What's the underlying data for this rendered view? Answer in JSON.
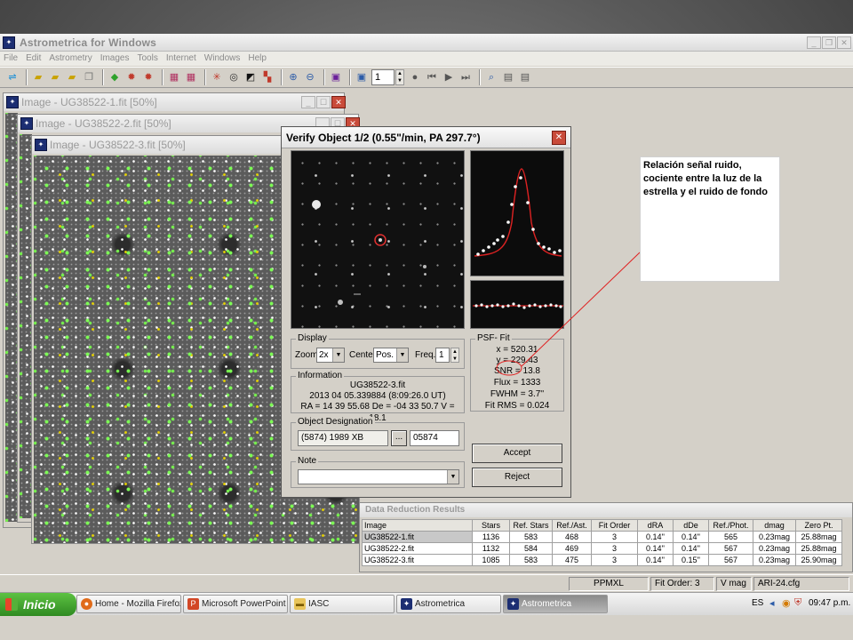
{
  "app": {
    "title": "Astrometrica for Windows",
    "menu": [
      "File",
      "Edit",
      "Astrometry",
      "Images",
      "Tools",
      "Internet",
      "Windows",
      "Help"
    ],
    "toolbar_field_value": "1"
  },
  "image_windows": [
    {
      "title": "Image - UG38522-1.fit [50%]"
    },
    {
      "title": "Image - UG38522-2.fit [50%]"
    },
    {
      "title": "Image - UG38522-3.fit [50%]"
    }
  ],
  "verify": {
    "title": "Verify Object 1/2 (0.55\"/min, PA 297.7°)",
    "display": {
      "label": "Display",
      "zoom_label": "Zoom",
      "zoom_value": "2x",
      "center_label": "Center",
      "center_value": "Pos. 2",
      "freq_label": "Freq.",
      "freq_value": "1"
    },
    "psf": {
      "label": "PSF- Fit",
      "x": "x = 520.31",
      "y": "y = 229.43",
      "snr": "SNR = 13.8",
      "flux": "Flux = 1333",
      "fwhm": "FWHM = 3.7''",
      "fit_rms": "Fit RMS = 0.024"
    },
    "information": {
      "label": "Information",
      "file": "UG38522-3.fit",
      "date": "2013 04 05.339884 (8:09:26.0 UT)",
      "coords": "RA = 14 39 55.68   De = -04 33 50.7   V = 18.1"
    },
    "designation": {
      "label": "Object Designation",
      "name": "(5874) 1989 XB",
      "browse": "...",
      "number": "05874"
    },
    "note": {
      "label": "Note",
      "value": ""
    },
    "accept_label": "Accept",
    "reject_label": "Reject"
  },
  "annotation": {
    "text": "Relación señal ruido, cociente entre la luz de la estrella y el ruido de fondo"
  },
  "data_reduction": {
    "title": "Data Reduction Results",
    "columns": [
      "Image",
      "Stars",
      "Ref. Stars",
      "Ref./Ast.",
      "Fit Order",
      "dRA",
      "dDe",
      "Ref./Phot.",
      "dmag",
      "Zero Pt."
    ],
    "rows": [
      [
        "UG38522-1.fit",
        "1136",
        "583",
        "468",
        "3",
        "0.14''",
        "0.14''",
        "565",
        "0.23mag",
        "25.88mag"
      ],
      [
        "UG38522-2.fit",
        "1132",
        "584",
        "469",
        "3",
        "0.14''",
        "0.14''",
        "567",
        "0.23mag",
        "25.88mag"
      ],
      [
        "UG38522-3.fit",
        "1085",
        "583",
        "475",
        "3",
        "0.14''",
        "0.15''",
        "567",
        "0.23mag",
        "25.90mag"
      ]
    ]
  },
  "statusbar": {
    "catalog": "PPMXL",
    "fit_order": "Fit Order: 3",
    "mag": "V mag",
    "config": "ARI-24.cfg"
  },
  "taskbar": {
    "start_label": "Inicio",
    "tasks": [
      "Home - Mozilla Firefox",
      "Microsoft PowerPoint ...",
      "IASC",
      "Astrometrica",
      "Astrometrica"
    ],
    "language": "ES",
    "clock": "09:47 p.m."
  }
}
